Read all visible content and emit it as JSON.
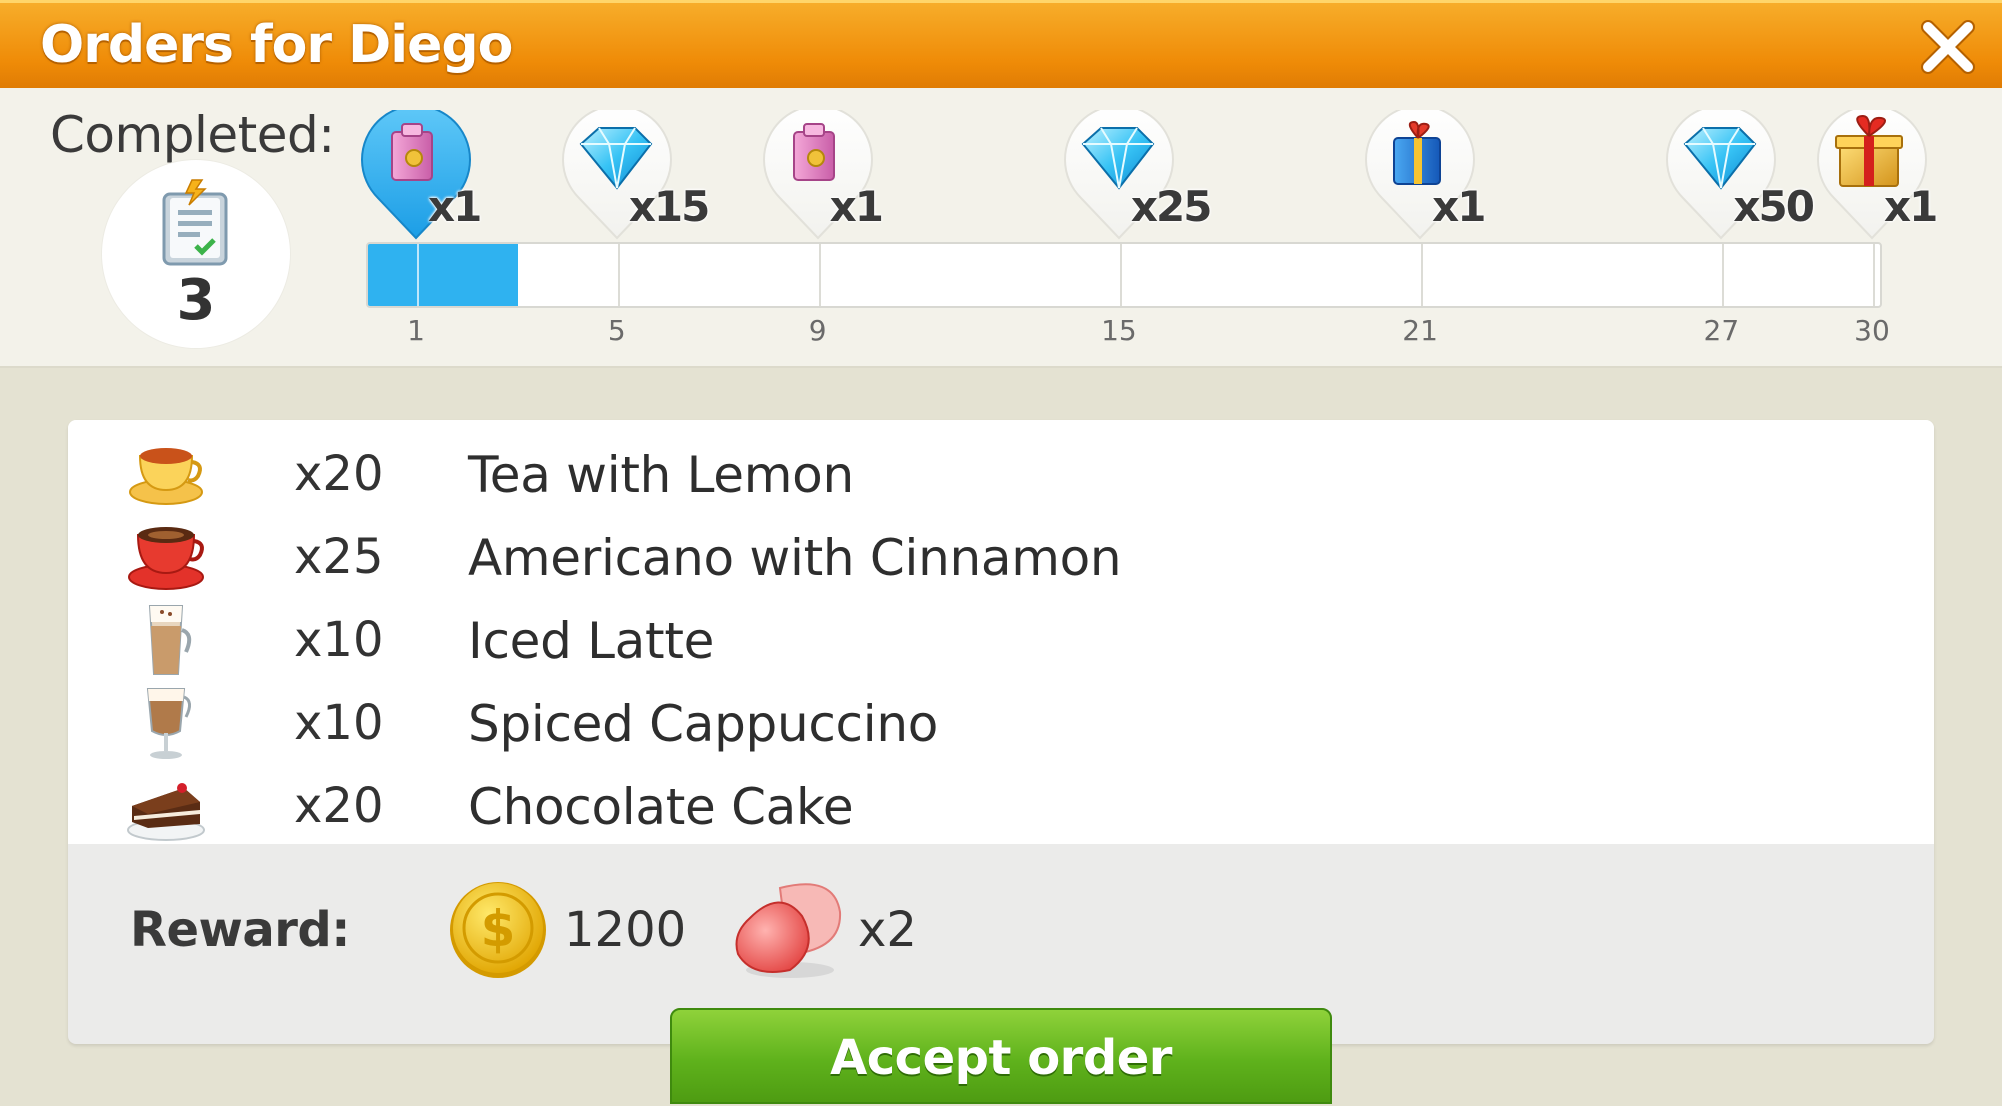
{
  "title": "Orders for Diego",
  "progress": {
    "completed_label": "Completed:",
    "completed_count": "3",
    "max": 30,
    "milestones": [
      {
        "value": "1",
        "reward_icon": "pink-bag-icon",
        "qty": "x1"
      },
      {
        "value": "5",
        "reward_icon": "blue-diamond-icon",
        "qty": "x15"
      },
      {
        "value": "9",
        "reward_icon": "pink-bag-icon",
        "qty": "x1"
      },
      {
        "value": "15",
        "reward_icon": "blue-diamond-icon",
        "qty": "x25"
      },
      {
        "value": "21",
        "reward_icon": "blue-gift-bag-icon",
        "qty": "x1"
      },
      {
        "value": "27",
        "reward_icon": "blue-diamond-icon",
        "qty": "x50"
      },
      {
        "value": "30",
        "reward_icon": "gold-gift-box-icon",
        "qty": "x1"
      }
    ]
  },
  "items": [
    {
      "icon": "tea-cup-icon",
      "qty": "x20",
      "name": "Tea with Lemon"
    },
    {
      "icon": "red-coffee-cup-icon",
      "qty": "x25",
      "name": "Americano with Cinnamon"
    },
    {
      "icon": "iced-latte-glass-icon",
      "qty": "x10",
      "name": "Iced Latte"
    },
    {
      "icon": "cappuccino-glass-icon",
      "qty": "x10",
      "name": "Spiced Cappuccino"
    },
    {
      "icon": "chocolate-cake-icon",
      "qty": "x20",
      "name": "Chocolate Cake"
    }
  ],
  "reward": {
    "label": "Reward:",
    "coins": "1200",
    "petals": "x2"
  },
  "accept_label": "Accept order",
  "colors": {
    "title_bar": "#f19a12",
    "progress_fill": "#2fb2f0",
    "accept_button": "#5fb21c"
  }
}
